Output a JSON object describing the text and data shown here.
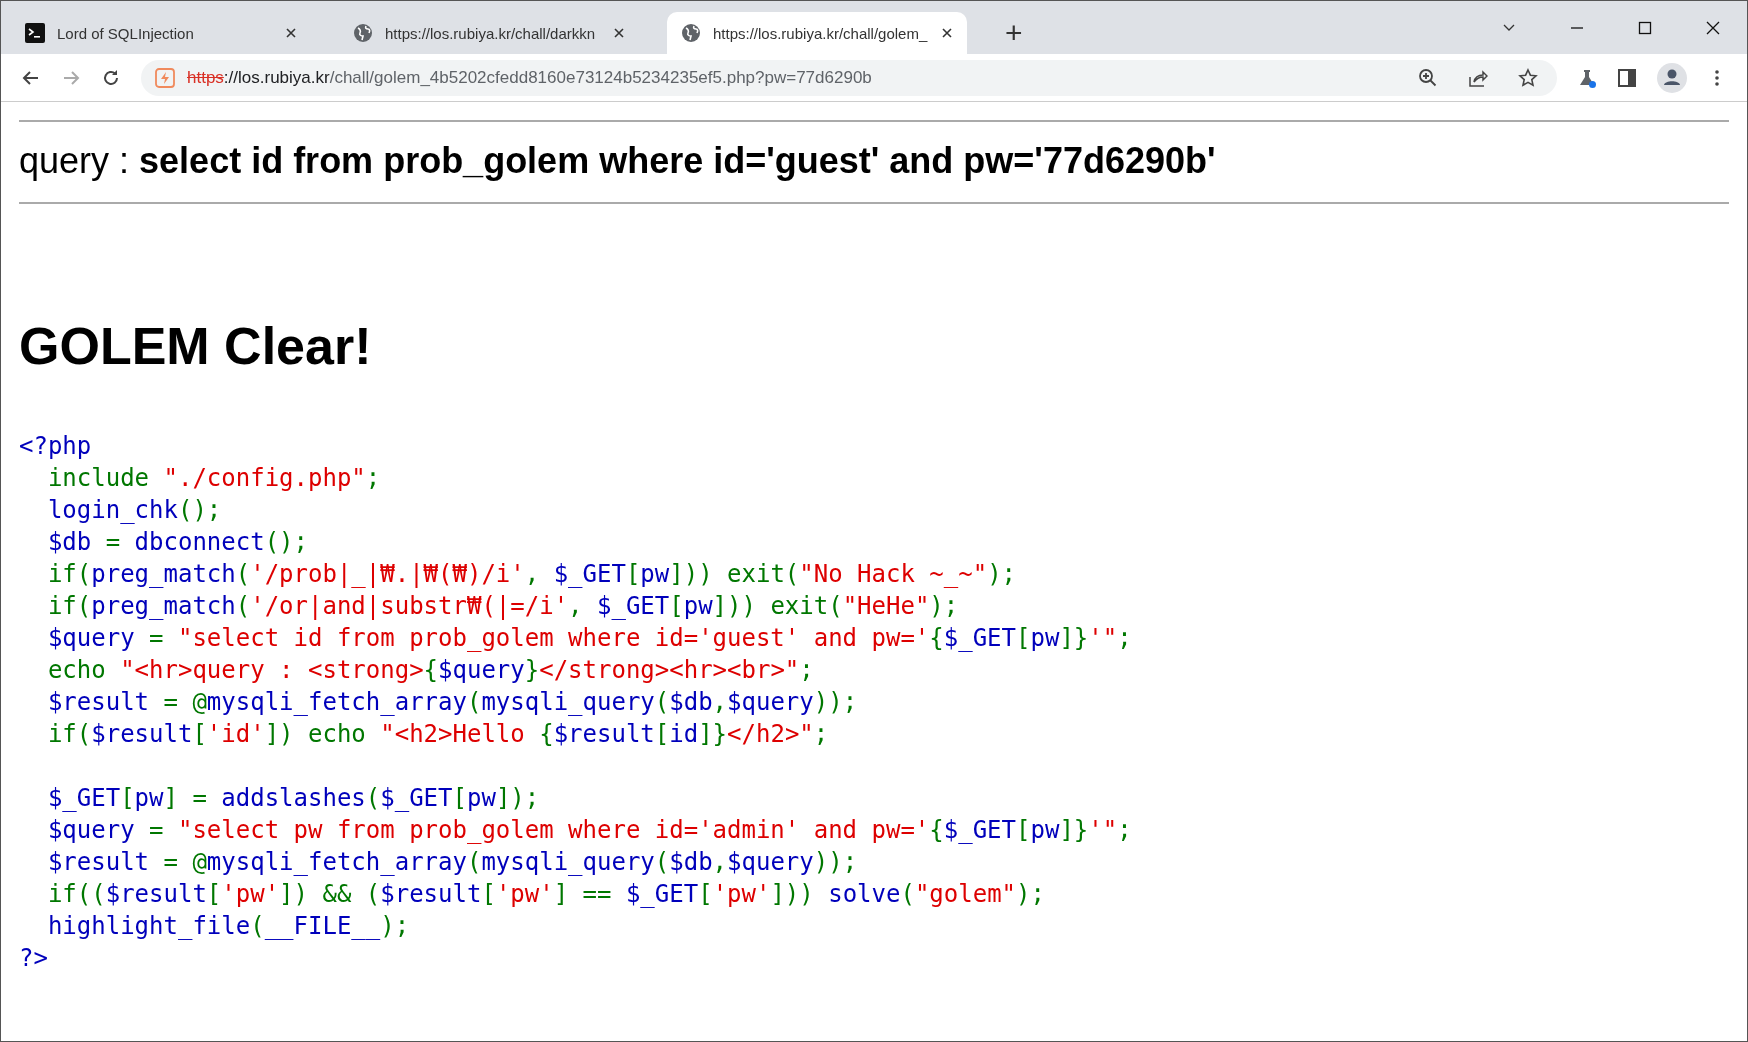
{
  "tabs": [
    {
      "title": "Lord of SQLInjection",
      "selected": false
    },
    {
      "title": "https://los.rubiya.kr/chall/darkkn",
      "selected": false
    },
    {
      "title": "https://los.rubiya.kr/chall/golem_",
      "selected": true
    }
  ],
  "new_tab": "+",
  "address_bar": {
    "scheme": "https",
    "host": "://los.rubiya.kr",
    "path": "/chall/golem_4b5202cfedd8160e73124b5234235ef5.php?pw=77d6290b"
  },
  "query_line": "query : **select id from prob_golem where id='guest' and pw='77d6290b'**",
  "heading": "GOLEM Clear!",
  "code": {
    "blocks": [
      [
        [
          {
            "kind": "d",
            "s": "<?php"
          }
        ],
        [
          {
            "kind": "k",
            "s": "  include "
          },
          {
            "kind": "s",
            "s": "\"./config.php\""
          },
          {
            "kind": "k",
            "s": ";"
          }
        ],
        [
          {
            "kind": "d",
            "s": "  login_chk"
          },
          {
            "kind": "k",
            "s": "();"
          }
        ],
        [
          {
            "kind": "d",
            "s": "  $db "
          },
          {
            "kind": "k",
            "s": "= "
          },
          {
            "kind": "d",
            "s": "dbconnect"
          },
          {
            "kind": "k",
            "s": "();"
          }
        ],
        [
          {
            "kind": "k",
            "s": "  if("
          },
          {
            "kind": "d",
            "s": "preg_match"
          },
          {
            "kind": "k",
            "s": "("
          },
          {
            "kind": "s",
            "s": "'/prob|_|₩.|₩(₩)/i'"
          },
          {
            "kind": "k",
            "s": ", "
          },
          {
            "kind": "d",
            "s": "$_GET"
          },
          {
            "kind": "k",
            "s": "["
          },
          {
            "kind": "d",
            "s": "pw"
          },
          {
            "kind": "k",
            "s": "])) exit("
          },
          {
            "kind": "s",
            "s": "\"No Hack ~_~\""
          },
          {
            "kind": "k",
            "s": ");"
          }
        ],
        [
          {
            "kind": "k",
            "s": "  if("
          },
          {
            "kind": "d",
            "s": "preg_match"
          },
          {
            "kind": "k",
            "s": "("
          },
          {
            "kind": "s",
            "s": "'/or|and|substr₩(|=/i'"
          },
          {
            "kind": "k",
            "s": ", "
          },
          {
            "kind": "d",
            "s": "$_GET"
          },
          {
            "kind": "k",
            "s": "["
          },
          {
            "kind": "d",
            "s": "pw"
          },
          {
            "kind": "k",
            "s": "])) exit("
          },
          {
            "kind": "s",
            "s": "\"HeHe\""
          },
          {
            "kind": "k",
            "s": ");"
          }
        ],
        [
          {
            "kind": "d",
            "s": "  $query "
          },
          {
            "kind": "k",
            "s": "= "
          },
          {
            "kind": "s",
            "s": "\"select id from prob_golem where id='guest' and pw='"
          },
          {
            "kind": "k",
            "s": "{"
          },
          {
            "kind": "d",
            "s": "$_GET"
          },
          {
            "kind": "k",
            "s": "["
          },
          {
            "kind": "d",
            "s": "pw"
          },
          {
            "kind": "k",
            "s": "]}"
          },
          {
            "kind": "s",
            "s": "'\""
          },
          {
            "kind": "k",
            "s": ";"
          }
        ],
        [
          {
            "kind": "k",
            "s": "  echo "
          },
          {
            "kind": "s",
            "s": "\"<hr>query : <strong>"
          },
          {
            "kind": "k",
            "s": "{"
          },
          {
            "kind": "d",
            "s": "$query"
          },
          {
            "kind": "k",
            "s": "}"
          },
          {
            "kind": "s",
            "s": "</strong><hr><br>\""
          },
          {
            "kind": "k",
            "s": ";"
          }
        ],
        [
          {
            "kind": "d",
            "s": "  $result "
          },
          {
            "kind": "k",
            "s": "= @"
          },
          {
            "kind": "d",
            "s": "mysqli_fetch_array"
          },
          {
            "kind": "k",
            "s": "("
          },
          {
            "kind": "d",
            "s": "mysqli_query"
          },
          {
            "kind": "k",
            "s": "("
          },
          {
            "kind": "d",
            "s": "$db"
          },
          {
            "kind": "k",
            "s": ","
          },
          {
            "kind": "d",
            "s": "$query"
          },
          {
            "kind": "k",
            "s": "));"
          }
        ],
        [
          {
            "kind": "k",
            "s": "  if("
          },
          {
            "kind": "d",
            "s": "$result"
          },
          {
            "kind": "k",
            "s": "["
          },
          {
            "kind": "s",
            "s": "'id'"
          },
          {
            "kind": "k",
            "s": "]) echo "
          },
          {
            "kind": "s",
            "s": "\"<h2>Hello "
          },
          {
            "kind": "k",
            "s": "{"
          },
          {
            "kind": "d",
            "s": "$result"
          },
          {
            "kind": "k",
            "s": "["
          },
          {
            "kind": "d",
            "s": "id"
          },
          {
            "kind": "k",
            "s": "]}"
          },
          {
            "kind": "s",
            "s": "</h2>\""
          },
          {
            "kind": "k",
            "s": ";"
          }
        ]
      ],
      [
        [
          {
            "kind": "d",
            "s": "  $_GET"
          },
          {
            "kind": "k",
            "s": "["
          },
          {
            "kind": "d",
            "s": "pw"
          },
          {
            "kind": "k",
            "s": "] = "
          },
          {
            "kind": "d",
            "s": "addslashes"
          },
          {
            "kind": "k",
            "s": "("
          },
          {
            "kind": "d",
            "s": "$_GET"
          },
          {
            "kind": "k",
            "s": "["
          },
          {
            "kind": "d",
            "s": "pw"
          },
          {
            "kind": "k",
            "s": "]);"
          }
        ],
        [
          {
            "kind": "d",
            "s": "  $query "
          },
          {
            "kind": "k",
            "s": "= "
          },
          {
            "kind": "s",
            "s": "\"select pw from prob_golem where id='admin' and pw='"
          },
          {
            "kind": "k",
            "s": "{"
          },
          {
            "kind": "d",
            "s": "$_GET"
          },
          {
            "kind": "k",
            "s": "["
          },
          {
            "kind": "d",
            "s": "pw"
          },
          {
            "kind": "k",
            "s": "]}"
          },
          {
            "kind": "s",
            "s": "'\""
          },
          {
            "kind": "k",
            "s": ";"
          }
        ],
        [
          {
            "kind": "d",
            "s": "  $result "
          },
          {
            "kind": "k",
            "s": "= @"
          },
          {
            "kind": "d",
            "s": "mysqli_fetch_array"
          },
          {
            "kind": "k",
            "s": "("
          },
          {
            "kind": "d",
            "s": "mysqli_query"
          },
          {
            "kind": "k",
            "s": "("
          },
          {
            "kind": "d",
            "s": "$db"
          },
          {
            "kind": "k",
            "s": ","
          },
          {
            "kind": "d",
            "s": "$query"
          },
          {
            "kind": "k",
            "s": "));"
          }
        ],
        [
          {
            "kind": "k",
            "s": "  if(("
          },
          {
            "kind": "d",
            "s": "$result"
          },
          {
            "kind": "k",
            "s": "["
          },
          {
            "kind": "s",
            "s": "'pw'"
          },
          {
            "kind": "k",
            "s": "]) && ("
          },
          {
            "kind": "d",
            "s": "$result"
          },
          {
            "kind": "k",
            "s": "["
          },
          {
            "kind": "s",
            "s": "'pw'"
          },
          {
            "kind": "k",
            "s": "] == "
          },
          {
            "kind": "d",
            "s": "$_GET"
          },
          {
            "kind": "k",
            "s": "["
          },
          {
            "kind": "s",
            "s": "'pw'"
          },
          {
            "kind": "k",
            "s": "])) "
          },
          {
            "kind": "d",
            "s": "solve"
          },
          {
            "kind": "k",
            "s": "("
          },
          {
            "kind": "s",
            "s": "\"golem\""
          },
          {
            "kind": "k",
            "s": ");"
          }
        ],
        [
          {
            "kind": "d",
            "s": "  highlight_file"
          },
          {
            "kind": "k",
            "s": "("
          },
          {
            "kind": "d",
            "s": "__FILE__"
          },
          {
            "kind": "k",
            "s": ");"
          }
        ],
        [
          {
            "kind": "d",
            "s": "?>"
          }
        ]
      ]
    ]
  }
}
